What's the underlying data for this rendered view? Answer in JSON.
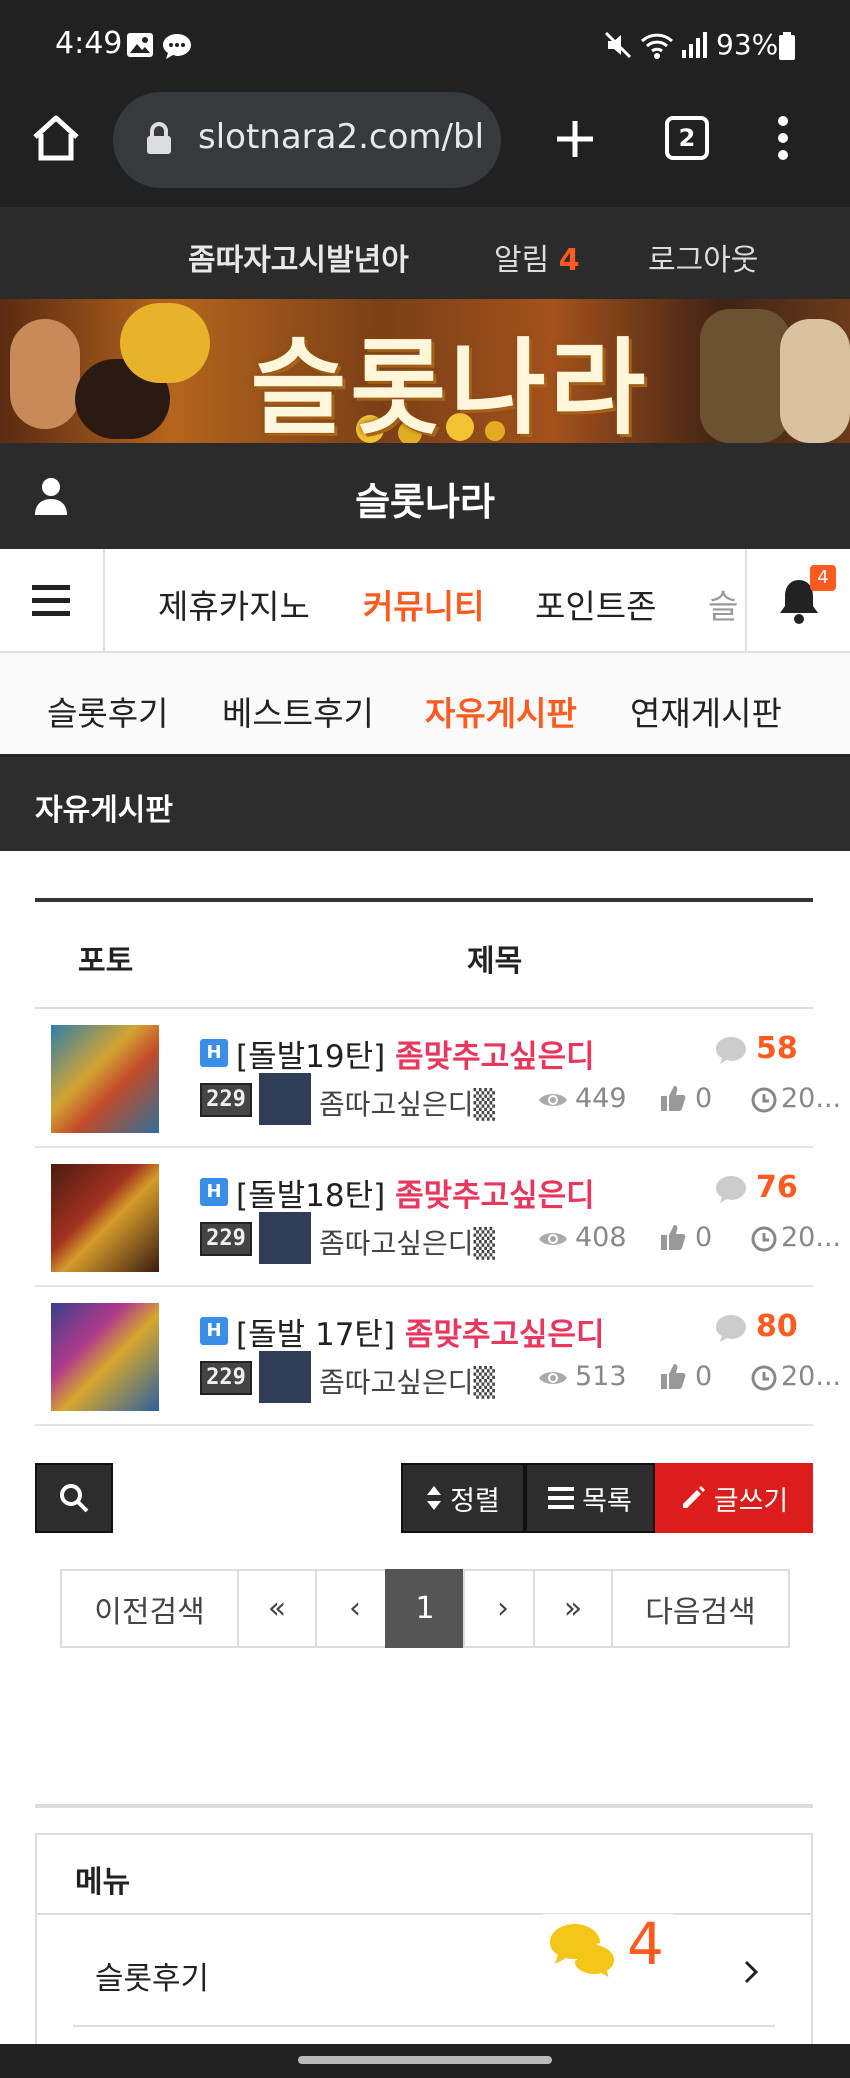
{
  "status": {
    "time": "4:49",
    "battery": "93%"
  },
  "browser": {
    "url": "slotnara2.com/bl",
    "tab_count": "2"
  },
  "userbar": {
    "username": "좀따자고시발년아",
    "notify_label": "알림",
    "notify_count": "4",
    "logout": "로그아웃"
  },
  "banner": {
    "title": "슬롯나라"
  },
  "site": {
    "name": "슬롯나라"
  },
  "mainnav": {
    "items": [
      "제휴카지노",
      "커뮤니티",
      "포인트존",
      "슬"
    ],
    "active_index": 1,
    "bell_badge": "4"
  },
  "subnav": {
    "items": [
      "슬롯후기",
      "베스트후기",
      "자유게시판",
      "연재게시판"
    ],
    "active_index": 2
  },
  "board": {
    "title": "자유게시판",
    "col_photo": "포토",
    "col_title": "제목"
  },
  "posts": [
    {
      "badge": "H",
      "prefix": "[돌발19탄]",
      "title": "좀맞추고싶은디",
      "comments": "58",
      "level": "229",
      "author": "좀따고싶은디▒",
      "views": "449",
      "likes": "0",
      "date": "20..."
    },
    {
      "badge": "H",
      "prefix": "[돌발18탄]",
      "title": "좀맞추고싶은디",
      "comments": "76",
      "level": "229",
      "author": "좀따고싶은디▒",
      "views": "408",
      "likes": "0",
      "date": "20..."
    },
    {
      "badge": "H",
      "prefix": "[돌발 17탄]",
      "title": "좀맞추고싶은디",
      "comments": "80",
      "level": "229",
      "author": "좀따고싶은디▒",
      "views": "513",
      "likes": "0",
      "date": "20..."
    }
  ],
  "actions": {
    "sort": "정렬",
    "list": "목록",
    "write": "글쓰기"
  },
  "pagination": {
    "prev_search": "이전검색",
    "first": "«",
    "prev": "‹",
    "current": "1",
    "next": "›",
    "last": "»",
    "next_search": "다음검색"
  },
  "menu": {
    "title": "메뉴",
    "items": [
      {
        "label": "슬롯후기"
      }
    ],
    "chat_count": "4"
  },
  "colors": {
    "accent": "#ff5a1f",
    "title_pink": "#e8365d",
    "write_red": "#dd1c1c",
    "dark": "#2b2b2b"
  }
}
